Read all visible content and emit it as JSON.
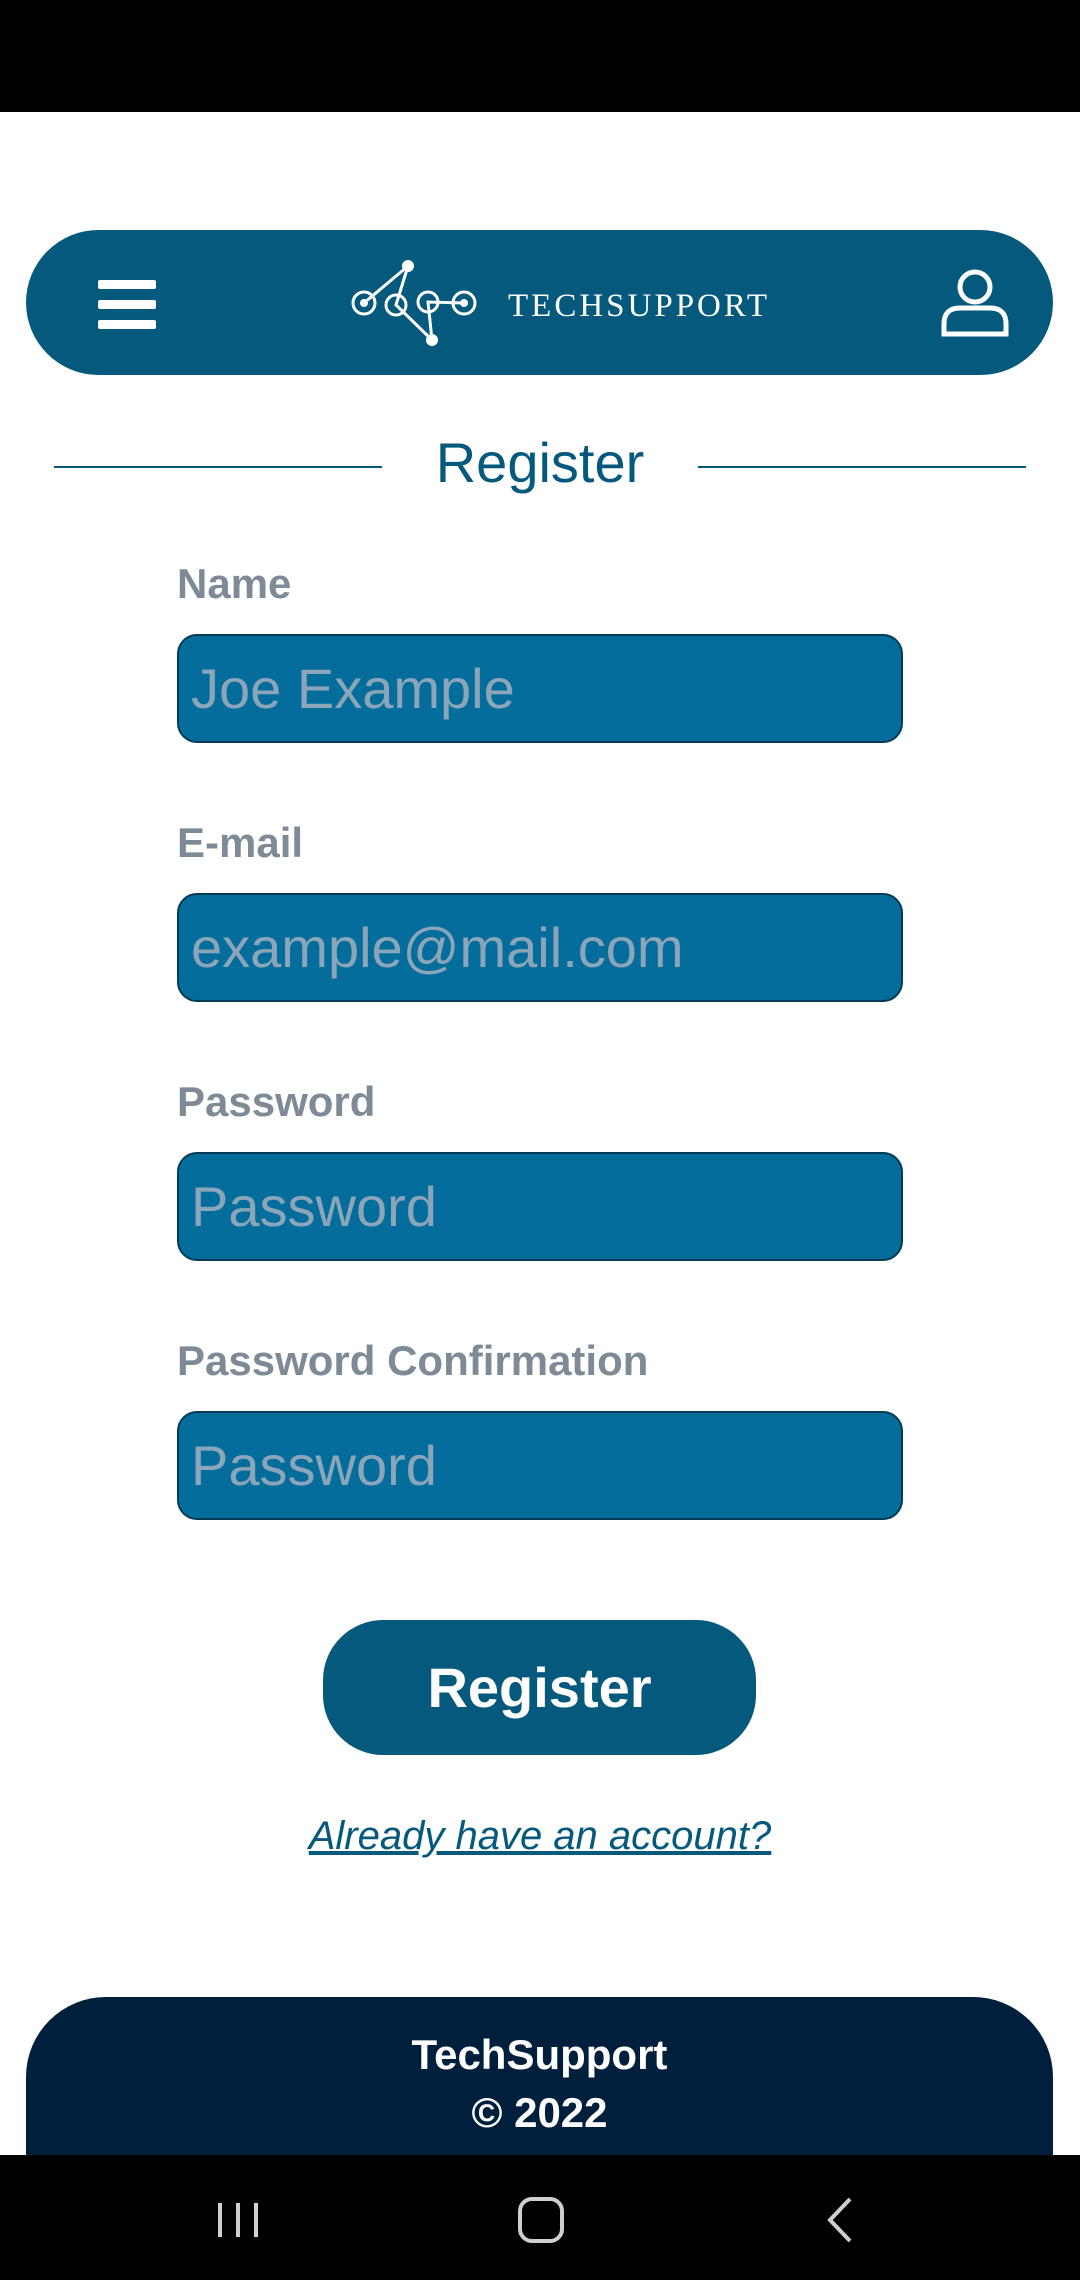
{
  "header": {
    "brand": "TECHSUPPORT",
    "icons": {
      "menu": "hamburger-icon",
      "logo": "gears-logo",
      "account": "user-icon"
    }
  },
  "page": {
    "title": "Register"
  },
  "form": {
    "fields": [
      {
        "label": "Name",
        "placeholder": "Joe Example",
        "value": ""
      },
      {
        "label": "E-mail",
        "placeholder": "example@mail.com",
        "value": ""
      },
      {
        "label": "Password",
        "placeholder": "Password",
        "value": ""
      },
      {
        "label": "Password Confirmation",
        "placeholder": "Password",
        "value": ""
      }
    ],
    "submit_label": "Register",
    "login_link": "Already have an account?"
  },
  "footer": {
    "brand": "TechSupport",
    "copyright": "© 2022"
  },
  "system_nav": {
    "icons": [
      "recent-apps-icon",
      "home-icon",
      "back-icon"
    ]
  },
  "colors": {
    "primary": "#04597d",
    "input_bg": "#056d9c",
    "footer_bg": "#001f3d",
    "label": "#7e8b97"
  }
}
